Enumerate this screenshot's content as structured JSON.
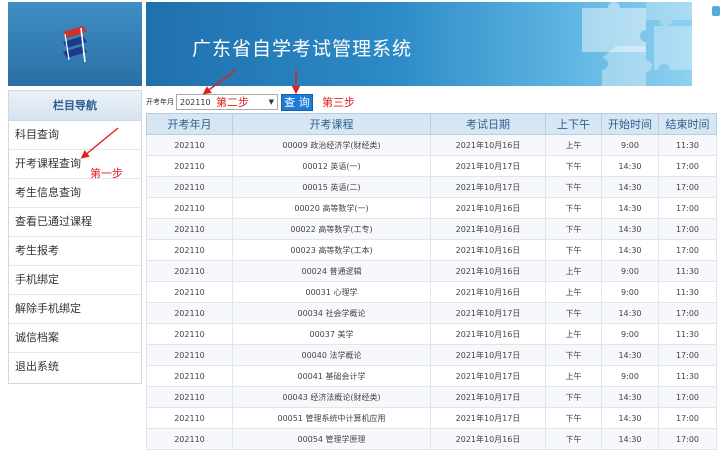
{
  "header": {
    "title": "广东省自学考试管理系统",
    "logo_icon": "exam-logo-icon"
  },
  "sidebar": {
    "heading": "栏目导航",
    "items": [
      {
        "label": "科目查询"
      },
      {
        "label": "开考课程查询"
      },
      {
        "label": "考生信息查询"
      },
      {
        "label": "查看已通过课程"
      },
      {
        "label": "考生报考"
      },
      {
        "label": "手机绑定"
      },
      {
        "label": "解除手机绑定"
      },
      {
        "label": "诚信档案"
      },
      {
        "label": "退出系统"
      }
    ]
  },
  "toolbar": {
    "label": "开考年月",
    "select_value": "202110",
    "button_label": "查 询"
  },
  "annotations": {
    "step1": "第一步",
    "step2": "第二步",
    "step3": "第三步",
    "color": "#e02020"
  },
  "table": {
    "headers": [
      "开考年月",
      "开考课程",
      "考试日期",
      "上下午",
      "开始时间",
      "结束时间"
    ],
    "rows": [
      [
        "202110",
        "00009 政治经济学(财经类)",
        "2021年10月16日",
        "上午",
        "9:00",
        "11:30"
      ],
      [
        "202110",
        "00012 英语(一)",
        "2021年10月17日",
        "下午",
        "14:30",
        "17:00"
      ],
      [
        "202110",
        "00015 英语(二)",
        "2021年10月17日",
        "下午",
        "14:30",
        "17:00"
      ],
      [
        "202110",
        "00020 高等数学(一)",
        "2021年10月16日",
        "下午",
        "14:30",
        "17:00"
      ],
      [
        "202110",
        "00022 高等数学(工专)",
        "2021年10月16日",
        "下午",
        "14:30",
        "17:00"
      ],
      [
        "202110",
        "00023 高等数学(工本)",
        "2021年10月16日",
        "下午",
        "14:30",
        "17:00"
      ],
      [
        "202110",
        "00024 普通逻辑",
        "2021年10月16日",
        "上午",
        "9:00",
        "11:30"
      ],
      [
        "202110",
        "00031 心理学",
        "2021年10月16日",
        "上午",
        "9:00",
        "11:30"
      ],
      [
        "202110",
        "00034 社会学概论",
        "2021年10月17日",
        "下午",
        "14:30",
        "17:00"
      ],
      [
        "202110",
        "00037 美学",
        "2021年10月16日",
        "上午",
        "9:00",
        "11:30"
      ],
      [
        "202110",
        "00040 法学概论",
        "2021年10月17日",
        "下午",
        "14:30",
        "17:00"
      ],
      [
        "202110",
        "00041 基础会计学",
        "2021年10月17日",
        "上午",
        "9:00",
        "11:30"
      ],
      [
        "202110",
        "00043 经济法概论(财经类)",
        "2021年10月17日",
        "下午",
        "14:30",
        "17:00"
      ],
      [
        "202110",
        "00051 管理系统中计算机应用",
        "2021年10月17日",
        "下午",
        "14:30",
        "17:00"
      ],
      [
        "202110",
        "00054 管理学原理",
        "2021年10月16日",
        "下午",
        "14:30",
        "17:00"
      ]
    ]
  },
  "colors": {
    "banner": "#2c8ac6",
    "button": "#1e7bd8",
    "table_header": "#d7e6f3"
  }
}
